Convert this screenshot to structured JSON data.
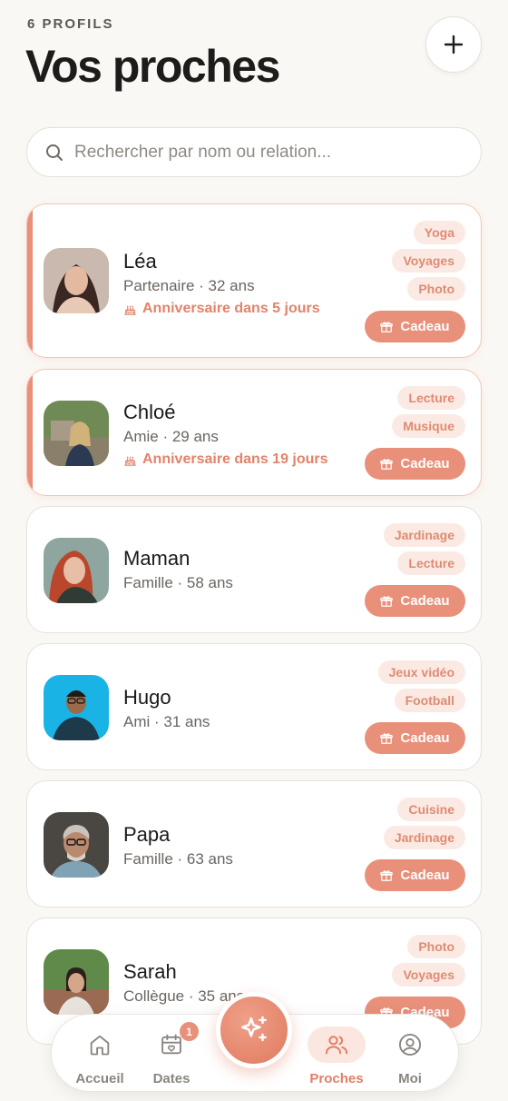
{
  "header": {
    "count": "6 PROFILS",
    "title": "Vos proches"
  },
  "search": {
    "placeholder": "Rechercher par nom ou relation..."
  },
  "cards": [
    {
      "name": "Léa",
      "sub": "Partenaire · 32 ans",
      "birthday": "Anniversaire dans 5 jours",
      "tags": [
        "Yoga",
        "Voyages",
        "Photo"
      ],
      "gift": "Cadeau"
    },
    {
      "name": "Chloé",
      "sub": "Amie · 29 ans",
      "birthday": "Anniversaire dans 19 jours",
      "tags": [
        "Lecture",
        "Musique"
      ],
      "gift": "Cadeau"
    },
    {
      "name": "Maman",
      "sub": "Famille · 58 ans",
      "tags": [
        "Jardinage",
        "Lecture"
      ],
      "gift": "Cadeau"
    },
    {
      "name": "Hugo",
      "sub": "Ami · 31 ans",
      "tags": [
        "Jeux vidéo",
        "Football"
      ],
      "gift": "Cadeau"
    },
    {
      "name": "Papa",
      "sub": "Famille · 63 ans",
      "tags": [
        "Cuisine",
        "Jardinage"
      ],
      "gift": "Cadeau"
    },
    {
      "name": "Sarah",
      "sub": "Collègue · 35 ans",
      "tags": [
        "Photo",
        "Voyages"
      ],
      "gift": "Cadeau"
    }
  ],
  "tabbar": {
    "accueil": "Accueil",
    "dates": "Dates",
    "dates_badge": "1",
    "proches": "Proches",
    "moi": "Moi"
  },
  "icons": {
    "add": "plus-icon",
    "search": "search-icon",
    "birthday": "cake-icon",
    "gift": "gift-icon",
    "fab": "sparkles-icon"
  },
  "colors": {
    "accent": "#e8907a",
    "tag_bg": "#fbeae3",
    "tag_text": "#df8b72",
    "background": "#faf8f4"
  }
}
